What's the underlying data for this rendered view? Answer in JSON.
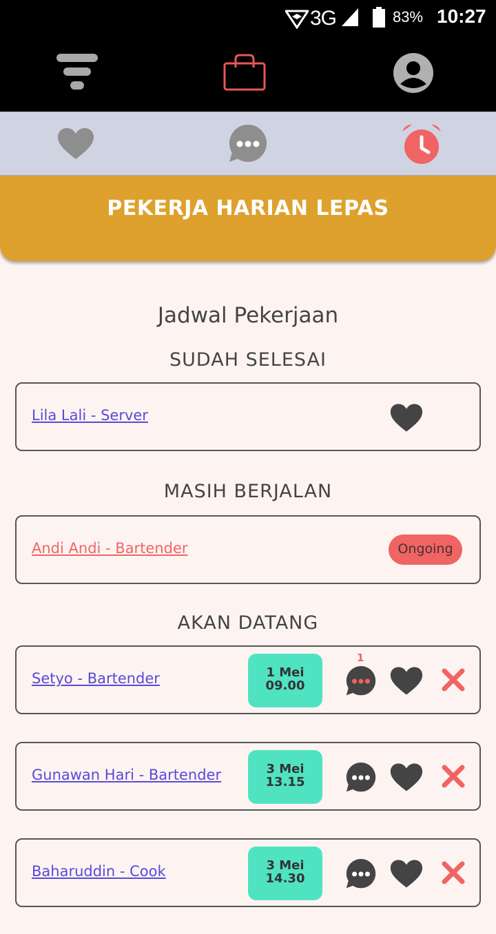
{
  "status_bar": {
    "network": "3G",
    "battery_percent": "83%",
    "time": "10:27"
  },
  "top_nav": {
    "items": [
      {
        "icon": "filter-icon",
        "active": false
      },
      {
        "icon": "shopping-bag-icon",
        "active": true
      },
      {
        "icon": "account-icon",
        "active": false
      }
    ]
  },
  "sub_tabs": {
    "items": [
      {
        "icon": "heart-icon",
        "active": false
      },
      {
        "icon": "chat-icon",
        "active": false
      },
      {
        "icon": "alarm-clock-icon",
        "active": true
      }
    ]
  },
  "banner": {
    "title": "PEKERJA HARIAN LEPAS"
  },
  "page": {
    "heading": "Jadwal Pekerjaan"
  },
  "sections": {
    "done": {
      "title": "SUDAH SELESAI",
      "items": [
        {
          "label": "Lila Lali - Server"
        }
      ]
    },
    "ongoing": {
      "title": "MASIH BERJALAN",
      "items": [
        {
          "label": "Andi Andi - Bartender",
          "badge": "Ongoing"
        }
      ]
    },
    "upcoming": {
      "title": "AKAN DATANG",
      "items": [
        {
          "label": "Setyo - Bartender",
          "date_day": "1 Mei",
          "date_time": "09.00",
          "chat_count": "1"
        },
        {
          "label": "Gunawan Hari - Bartender",
          "date_day": "3 Mei",
          "date_time": "13.15"
        },
        {
          "label": "Baharuddin - Cook",
          "date_day": "3 Mei",
          "date_time": "14.30"
        }
      ]
    }
  },
  "colors": {
    "banner": "#dea12e",
    "accent_red": "#f06464",
    "date_badge": "#50e3c2",
    "link_purple": "#5a49d6",
    "tab_bar": "#cfd3e2",
    "background": "#fdf4f2"
  }
}
